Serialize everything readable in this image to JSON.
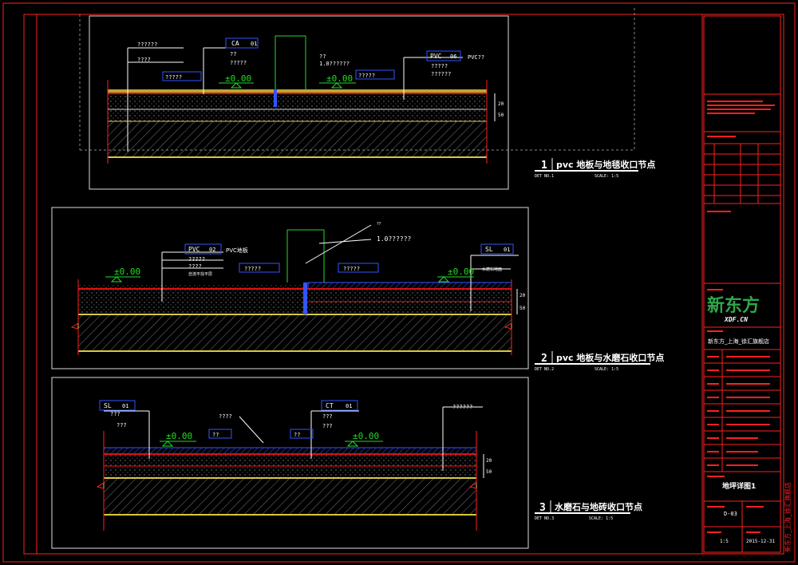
{
  "detail1": {
    "tags": {
      "ca": "CA",
      "ca_num": "01",
      "pvc": "PVC",
      "pvc_num": "06"
    },
    "notes_left": [
      "??????",
      "????"
    ],
    "notes_ca": [
      "??",
      "?????"
    ],
    "notes_mid": [
      "??",
      "1.0??????"
    ],
    "notes_pvc": [
      "PVC??",
      "?????",
      "??????"
    ],
    "blue_labels": [
      "?????",
      "?????"
    ],
    "elevation_a": "±0.00",
    "elevation_b": "±0.00",
    "dim_a": "20",
    "dim_b": "50",
    "title_num": "1",
    "title": "pvc 地板与地毯收口节点",
    "scale": "SCALE: 1:5",
    "sub": "DET NO.1"
  },
  "detail2": {
    "tags": {
      "pvc": "PVC",
      "pvc_num": "02",
      "pvc_suffix": "PVC地板",
      "sl": "SL",
      "sl_num": "01"
    },
    "notes_pvc": [
      "?????",
      "????",
      "自流平找平层"
    ],
    "notes_mid": [
      "??",
      "1.0??????"
    ],
    "notes_sl": [
      "水磨石地面"
    ],
    "blue_labels": [
      "?????",
      "?????"
    ],
    "elevation_a": "±0.00",
    "elevation_b": "±0.00",
    "dim_a": "20",
    "dim_b": "50",
    "title_num": "2",
    "title": "pvc 地板与水磨石收口节点",
    "scale": "SCALE: 1:5",
    "sub": "DET NO.2"
  },
  "detail3": {
    "tags": {
      "sl": "SL",
      "sl_num": "01",
      "ct": "CT",
      "ct_num": "01"
    },
    "notes_sl": [
      "???",
      "???"
    ],
    "notes_mid": [
      "????"
    ],
    "notes_ct": [
      "???",
      "???"
    ],
    "notes_right": [
      "??????"
    ],
    "blue_labels": [
      "??",
      "??"
    ],
    "elevation_a": "±0.00",
    "elevation_b": "±0.00",
    "dim_a": "20",
    "dim_b": "50",
    "title_num": "3",
    "title": "水磨石与地砖收口节点",
    "scale": "SCALE: 1:5",
    "sub": "DET NO.3"
  },
  "title_block": {
    "logo": "新东方",
    "logo_sub": "XDF.CN",
    "project": "新东方_上海_徐汇旗舰店",
    "drawing_name": "地坪详图1",
    "drawing_no": "D-03",
    "scale": "1:5",
    "date": "2015-12-31",
    "vertical_text": "新东方_上海_徐汇旗舰店"
  },
  "colors": {
    "frame": "#ff2020",
    "line": "#ffffff",
    "green": "#22dd22",
    "blue": "#2244ff",
    "yellow": "#d8c840",
    "red_layer": "#e01010"
  }
}
